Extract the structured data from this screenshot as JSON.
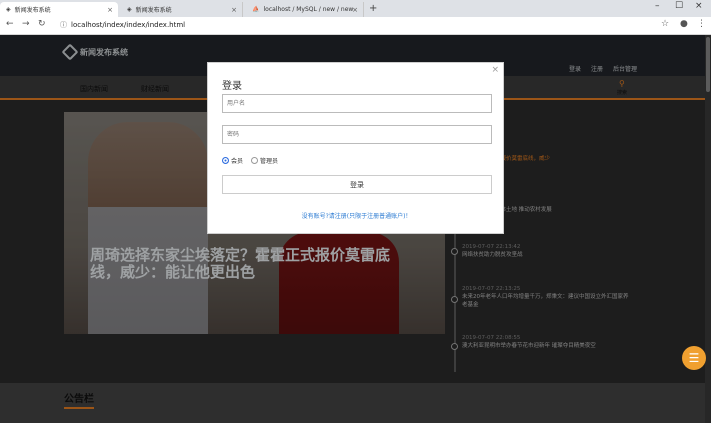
{
  "browser": {
    "tabs": [
      {
        "title": "新闻发布系统",
        "active": true
      },
      {
        "title": "新闻发布系统",
        "active": false
      },
      {
        "title": "localhost / MySQL / new / new",
        "active": false
      }
    ],
    "url": "localhost/index/index/index.html"
  },
  "site": {
    "logo_text": "新闻发布系统",
    "top_links": [
      "登录",
      "注册",
      "后台管理"
    ],
    "nav": [
      "国内新闻",
      "财经新闻"
    ],
    "search_label": "搜索",
    "hero_caption": "周琦选择东家尘埃落定？霍霍正式报价莫雷底线，威少：能让他更出色",
    "timeline": [
      {
        "time": "",
        "title": "落定？霍霍正式报价莫雷底线，威少",
        "hot": true
      },
      {
        "time": "",
        "title": "名方呼吁松绑集体土地 推动农村发展",
        "hot": false
      },
      {
        "time": "2019-07-07 22:13:42",
        "title": "网络扶贫助力脱贫攻坚战",
        "hot": false
      },
      {
        "time": "2019-07-07 22:13:25",
        "title": "未来20年老年人口年均增量千万，郑秉文：建议中国设立外汇国家养老基金",
        "hot": false
      },
      {
        "time": "2019-07-07 22:08:55",
        "title": "澳大利亚昆明市举办春节花市迎新年 璀璨夺目精美夜空",
        "hot": false
      }
    ],
    "notice_title": "公告栏"
  },
  "modal": {
    "title": "登录",
    "username_placeholder": "用户名",
    "password_placeholder": "密码",
    "role_member": "会员",
    "role_admin": "管理员",
    "login_button": "登录",
    "register_link": "没有账号?请注册(只限于注册普通账户)！"
  },
  "colors": {
    "accent": "#e67e22",
    "header_bg": "#22262b",
    "link": "#2a7ad2"
  }
}
